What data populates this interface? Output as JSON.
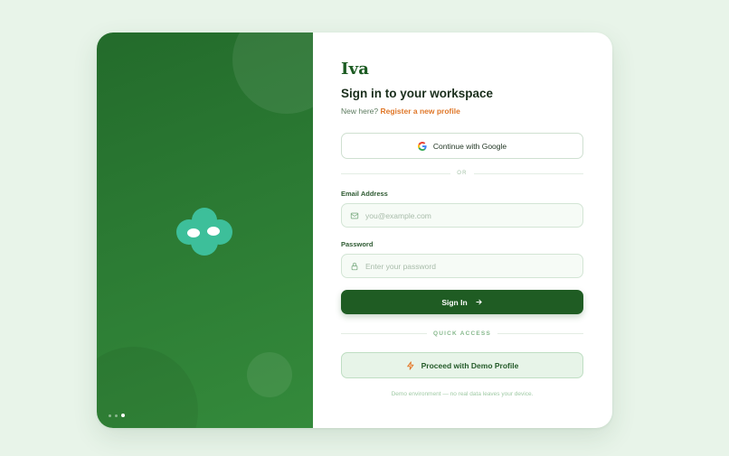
{
  "brand": {
    "name": "Iva"
  },
  "form": {
    "title": "Sign in to your workspace",
    "subtitle_prefix": "New here?",
    "register_link": "Register a new profile",
    "google_label": "Continue with Google",
    "divider_or": "OR",
    "email_label": "Email Address",
    "email_placeholder": "you@example.com",
    "password_label": "Password",
    "password_placeholder": "Enter your password",
    "signin_label": "Sign In",
    "quick_access": "QUICK ACCESS",
    "demo_label": "Proceed with Demo Profile",
    "footnote": "Demo environment — no real data leaves your device."
  },
  "hero": {
    "carousel_active_index": 2,
    "carousel_count": 3
  },
  "icons": {
    "google": "google-icon",
    "mail": "mail-icon",
    "lock": "lock-icon",
    "arrow": "arrow-right-icon",
    "bolt": "lightning-icon",
    "mascot": "cloud-mascot-icon"
  },
  "colors": {
    "primary": "#1f5c23",
    "hero_green": "#2b7a33",
    "accent_link": "#e0782a",
    "mascot": "#3dbf9a",
    "background": "#e8f4e9"
  }
}
